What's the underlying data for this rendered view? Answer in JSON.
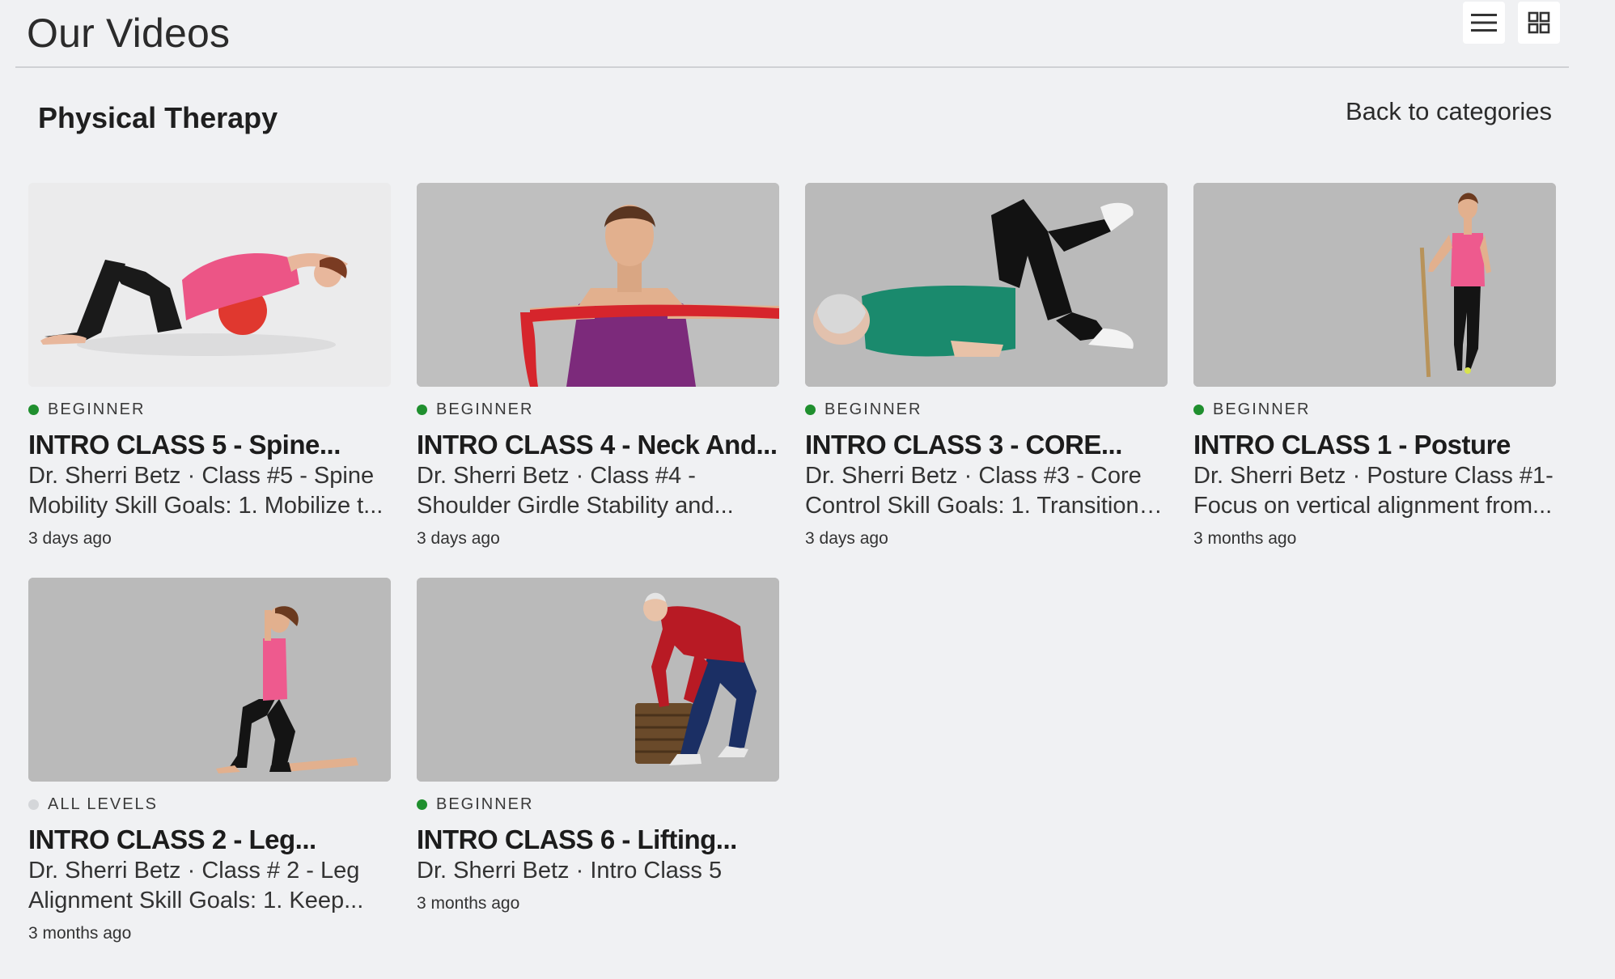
{
  "header": {
    "title": "Our Videos",
    "list_view_icon": "list-view-icon",
    "grid_view_icon": "grid-view-icon"
  },
  "section": {
    "title": "Physical Therapy",
    "back_link": "Back to categories"
  },
  "colors": {
    "beginner_dot": "#1f8f2e",
    "all_levels_dot": "#d4d6d9",
    "background": "#f0f1f3"
  },
  "videos": [
    {
      "level": "BEGINNER",
      "title": "INTRO CLASS 5 - Spine...",
      "description": "Dr. Sherri Betz · Class #5 - Spine Mobility Skill Goals: 1. Mobilize t...",
      "date": "3 days ago"
    },
    {
      "level": "BEGINNER",
      "title": "INTRO CLASS 4 - Neck And...",
      "description": "Dr. Sherri Betz · Class #4 - Shoulder Girdle Stability and...",
      "date": "3 days ago"
    },
    {
      "level": "BEGINNER",
      "title": "INTRO CLASS 3 - CORE...",
      "description": "Dr. Sherri Betz · Class #3 - Core Control Skill Goals: 1. Transition t...",
      "date": "3 days ago"
    },
    {
      "level": "BEGINNER",
      "title": "INTRO CLASS 1 - Posture",
      "description": "Dr. Sherri Betz · Posture Class #1- Focus on vertical alignment from...",
      "date": "3 months ago"
    },
    {
      "level": "ALL LEVELS",
      "title": "INTRO CLASS 2 - Leg...",
      "description": "Dr. Sherri Betz · Class # 2 - Leg Alignment Skill Goals: 1. Keep...",
      "date": "3 months ago"
    },
    {
      "level": "BEGINNER",
      "title": "INTRO CLASS 6 - Lifting...",
      "description": "Dr. Sherri Betz · Intro Class 5",
      "date": "3 months ago"
    }
  ]
}
